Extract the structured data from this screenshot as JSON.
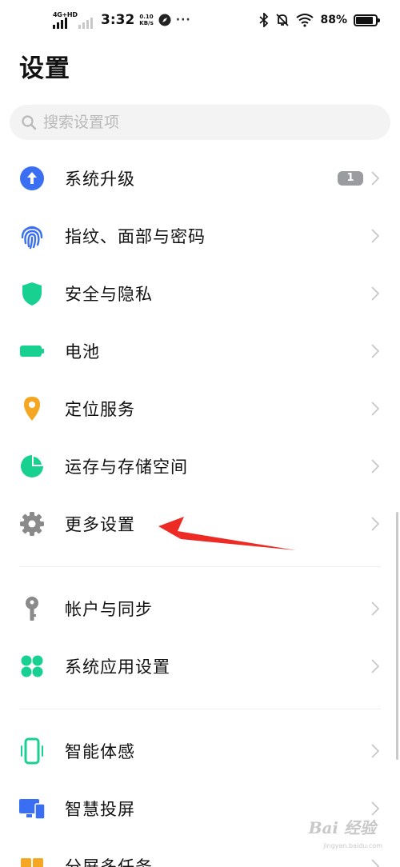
{
  "status_bar": {
    "network": "4G+HD",
    "time": "3:32",
    "speed_value": "0.10",
    "speed_unit": "KB/s",
    "overflow": "···",
    "battery": "88%",
    "battery_level": 0.88
  },
  "page_title": "设置",
  "search": {
    "placeholder": "搜索设置项"
  },
  "settings": [
    {
      "label": "系统升级",
      "icon": "arrow-up-circle-icon",
      "color": "#3b6ff3",
      "badge": "1"
    },
    {
      "label": "指纹、面部与密码",
      "icon": "fingerprint-icon",
      "color": "#3b6ff3"
    },
    {
      "label": "安全与隐私",
      "icon": "shield-icon",
      "color": "#18d191"
    },
    {
      "label": "电池",
      "icon": "battery-icon",
      "color": "#18d191"
    },
    {
      "label": "定位服务",
      "icon": "location-pin-icon",
      "color": "#f5a623"
    },
    {
      "label": "运存与存储空间",
      "icon": "pie-chart-icon",
      "color": "#18d191"
    },
    {
      "label": "更多设置",
      "icon": "gear-icon",
      "color": "#8a8a8a"
    },
    {
      "label": "帐户与同步",
      "icon": "key-icon",
      "color": "#8a8a8a"
    },
    {
      "label": "系统应用设置",
      "icon": "apps-grid-icon",
      "color": "#18d191"
    },
    {
      "label": "智能体感",
      "icon": "phone-motion-icon",
      "color": "#18d191"
    },
    {
      "label": "智慧投屏",
      "icon": "screen-cast-icon",
      "color": "#3b6ff3"
    },
    {
      "label": "分屏多任务",
      "icon": "split-screen-icon",
      "color": "#f5a623"
    }
  ],
  "watermark": {
    "text": "Bai 经验",
    "sub": "jingyan.baidu.com"
  }
}
